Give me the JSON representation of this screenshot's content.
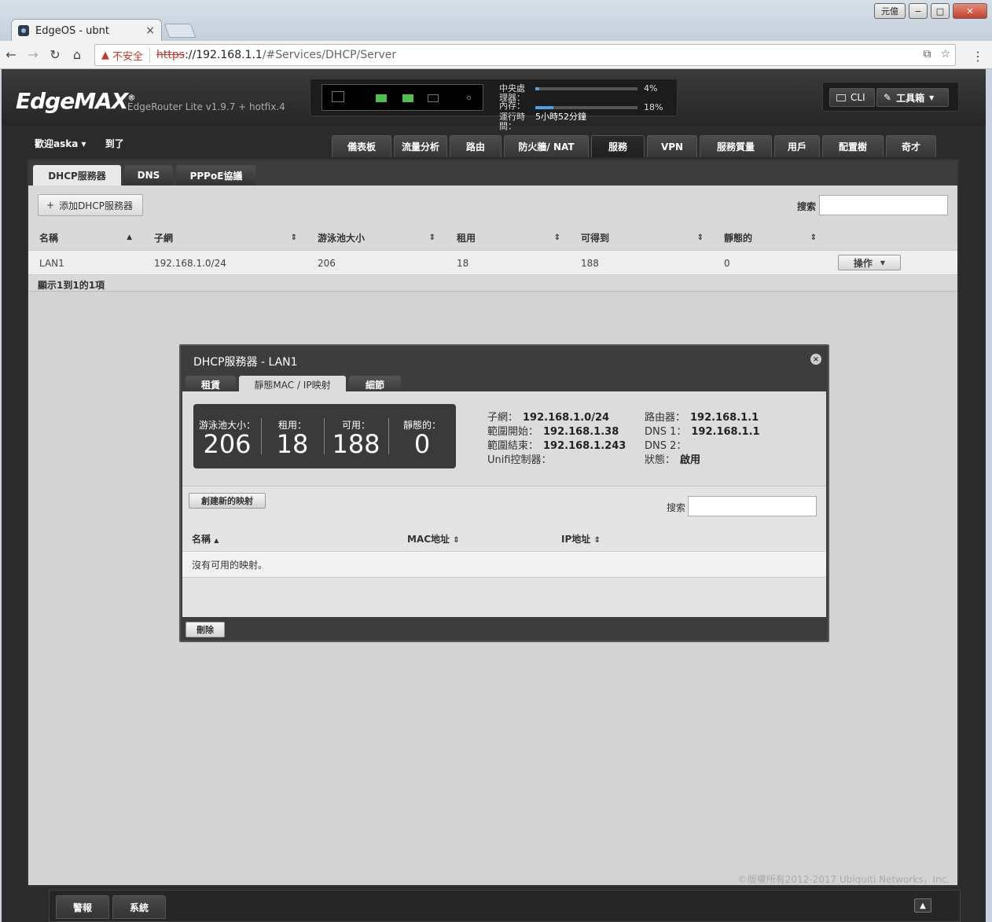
{
  "window": {
    "user_button": "元億",
    "min": "−",
    "max": "□",
    "close": "✕"
  },
  "browser": {
    "tab_title": "EdgeOS - ubnt",
    "tab_close": "×",
    "not_secure": "不安全",
    "url_protocol": "https",
    "url_host": "://192.168.1.1",
    "url_path": "/#Services/DHCP/Server"
  },
  "header": {
    "logo": "EdgeMAX",
    "model": "EdgeRouter Lite v1.9.7 + hotfix.4",
    "cpu_label": "中央處理器：",
    "cpu_pct": "4%",
    "cpu_value": 0.04,
    "mem_label": "內存：",
    "mem_pct": "18%",
    "mem_value": 0.18,
    "uptime_label": "運行時間：",
    "uptime": "5小時52分鐘",
    "cli": "CLI",
    "toolbox": "工具箱"
  },
  "user": {
    "welcome": "歡迎aska",
    "arrived": "到了"
  },
  "nav": [
    "儀表板",
    "流量分析",
    "路由",
    "防火牆/ NAT",
    "服務",
    "VPN",
    "服務質量",
    "用戶",
    "配置樹",
    "奇才"
  ],
  "subtabs": [
    "DHCP服務器",
    "DNS",
    "PPPoE協議"
  ],
  "toolbar": {
    "add_button": "添加DHCP服務器",
    "search_label": "搜索"
  },
  "table": {
    "headers": [
      "名稱",
      "子網",
      "游泳池大小",
      "租用",
      "可得到",
      "靜態的"
    ],
    "rows": [
      {
        "name": "LAN1",
        "subnet": "192.168.1.0/24",
        "pool": "206",
        "leased": "18",
        "available": "188",
        "static": "0",
        "action": "操作"
      }
    ],
    "footer": "顯示1到1的1項"
  },
  "modal": {
    "title": "DHCP服務器 - LAN1",
    "tabs": [
      "租賃",
      "靜態MAC / IP映射",
      "細節"
    ],
    "summary": [
      {
        "label": "游泳池大小：",
        "value": "206"
      },
      {
        "label": "租用：",
        "value": "18"
      },
      {
        "label": "可用：",
        "value": "188"
      },
      {
        "label": "靜態的：",
        "value": "0"
      }
    ],
    "info_left": [
      {
        "label": "子網：",
        "value": "192.168.1.0/24"
      },
      {
        "label": "範圍開始：",
        "value": "192.168.1.38"
      },
      {
        "label": "範圍結束：",
        "value": "192.168.1.243"
      },
      {
        "label": "Unifi控制器：",
        "value": ""
      }
    ],
    "info_right": [
      {
        "label": "路由器：",
        "value": "192.168.1.1"
      },
      {
        "label": "DNS 1：",
        "value": "192.168.1.1"
      },
      {
        "label": "DNS 2：",
        "value": ""
      },
      {
        "label": "狀態：",
        "value": "啟用"
      }
    ],
    "create_button": "創建新的映射",
    "search_label": "搜索",
    "headers": [
      "名稱",
      "MAC地址",
      "IP地址"
    ],
    "empty": "沒有可用的映射。",
    "delete_button": "刪除"
  },
  "footer": {
    "copyright": "©版權所有2012-2017 Ubiquiti Networks，Inc.",
    "buttons": [
      "警報",
      "系統"
    ]
  }
}
